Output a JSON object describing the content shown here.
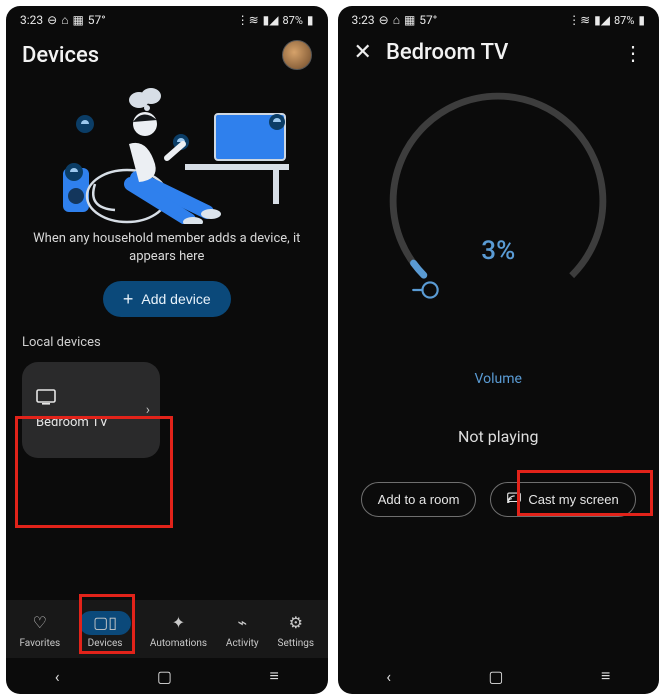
{
  "status": {
    "time": "3:23",
    "temp": "57°",
    "battery": "87%"
  },
  "left": {
    "title": "Devices",
    "hint": "When any household member adds a device, it appears here",
    "add_label": "Add device",
    "section": "Local devices",
    "device": {
      "name": "Bedroom TV"
    },
    "nav": {
      "favorites": "Favorites",
      "devices": "Devices",
      "automations": "Automations",
      "activity": "Activity",
      "settings": "Settings"
    }
  },
  "right": {
    "title": "Bedroom TV",
    "volume_pct": "3%",
    "volume_label": "Volume",
    "not_playing": "Not playing",
    "add_room": "Add to a room",
    "cast": "Cast my screen"
  }
}
